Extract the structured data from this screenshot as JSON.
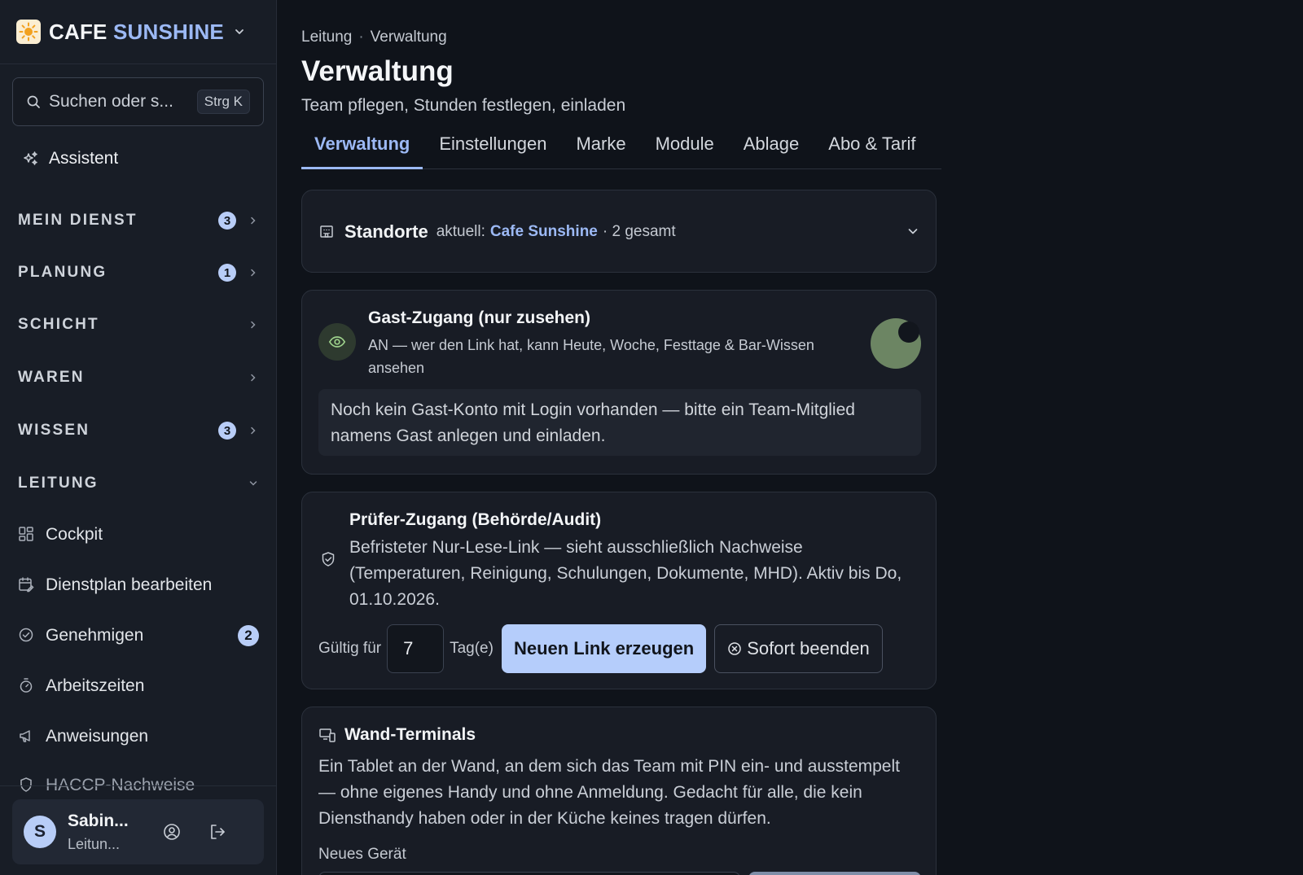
{
  "brand": {
    "name_part1": "CAFE",
    "name_part2": "SUNSHINE"
  },
  "search": {
    "placeholder": "Suchen oder s...",
    "shortcut": "Strg K"
  },
  "assistant": {
    "label": "Assistent"
  },
  "sections": [
    {
      "label": "MEIN DIENST",
      "badge": "3"
    },
    {
      "label": "PLANUNG",
      "badge": "1"
    },
    {
      "label": "SCHICHT"
    },
    {
      "label": "WAREN"
    },
    {
      "label": "WISSEN",
      "badge": "3"
    },
    {
      "label": "LEITUNG"
    }
  ],
  "leitung_items": [
    {
      "label": "Cockpit",
      "icon": "dashboard-grid-icon"
    },
    {
      "label": "Dienstplan bearbeiten",
      "icon": "calendar-edit-icon"
    },
    {
      "label": "Genehmigen",
      "icon": "check-circle-icon",
      "badge": "2"
    },
    {
      "label": "Arbeitszeiten",
      "icon": "stopwatch-icon"
    },
    {
      "label": "Anweisungen",
      "icon": "megaphone-icon"
    },
    {
      "label": "HACCP-Nachweise",
      "icon": "shield-icon"
    }
  ],
  "user": {
    "initial": "S",
    "name": "Sabin...",
    "role": "Leitun..."
  },
  "breadcrumb": {
    "parent": "Leitung",
    "current": "Verwaltung"
  },
  "page": {
    "title": "Verwaltung",
    "subtitle": "Team pflegen, Stunden festlegen, einladen"
  },
  "tabs": [
    "Verwaltung",
    "Einstellungen",
    "Marke",
    "Module",
    "Ablage",
    "Abo & Tarif"
  ],
  "standorte": {
    "title": "Standorte",
    "current_prefix": "aktuell:",
    "current_location": "Cafe Sunshine",
    "total": "· 2 gesamt"
  },
  "guest_access": {
    "title": "Gast-Zugang (nur zusehen)",
    "description": "AN — wer den Link hat, kann Heute, Woche, Festtage & Bar-Wissen ansehen",
    "enabled": true,
    "note": "Noch kein Gast-Konto mit Login vorhanden — bitte ein Team-Mitglied namens Gast anlegen und einladen."
  },
  "audit_access": {
    "title": "Prüfer-Zugang (Behörde/Audit)",
    "description": "Befristeter Nur-Lese-Link — sieht ausschließlich Nachweise (Temperaturen, Reinigung, Schulungen, Dokumente, MHD). Aktiv bis Do, 01.10.2026.",
    "valid_label": "Gültig für",
    "days_value": "7",
    "days_unit": "Tag(e)",
    "generate_button": "Neuen Link erzeugen",
    "end_button": "Sofort beenden"
  },
  "wall_terminals": {
    "title": "Wand-Terminals",
    "description": "Ein Tablet an der Wand, an dem sich das Team mit PIN ein- und ausstempelt — ohne eigenes Handy und ohne Anmeldung. Gedacht für alle, die kein Diensthandy haben oder in der Küche keines tragen dürfen.",
    "new_device_label": "Neues Gerät"
  },
  "colors": {
    "accent": "#9cb9f5",
    "primary_button": "#b5cdfb",
    "toggle_on": "#6c8563",
    "background": "#0f131a",
    "sidebar": "#181d26"
  }
}
